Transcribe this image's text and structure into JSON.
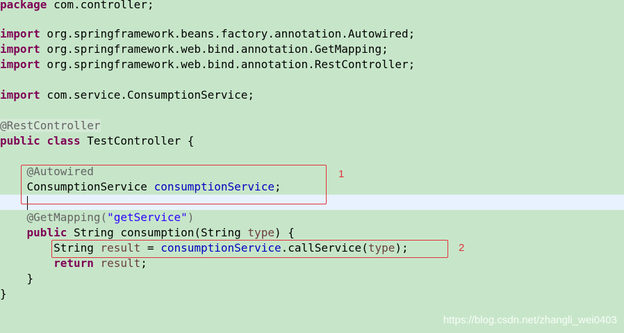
{
  "code": {
    "package_kw": "package",
    "package_name": " com.controller;",
    "import_kw": "import",
    "import1": " org.springframework.beans.factory.annotation.Autowired;",
    "import2": " org.springframework.web.bind.annotation.GetMapping;",
    "import3": " org.springframework.web.bind.annotation.RestController;",
    "import4": " com.service.ConsumptionService;",
    "ann_restcontroller": "@RestController",
    "public_kw": "public",
    "class_kw": "class",
    "class_decl": " TestController {",
    "ann_autowired": "@Autowired",
    "field_type": "ConsumptionService ",
    "field_name": "consumptionService",
    "semicolon": ";",
    "ann_getmapping": "@GetMapping(",
    "mapping_value": "\"getService\"",
    "close_paren": ")",
    "method_sig_a": " String consumption(String ",
    "param_type": "type",
    "method_sig_b": ") {",
    "stmt_type": "String ",
    "var_result": "result",
    "equals": " = ",
    "call_field": "consumptionService",
    "call_method": ".callService(",
    "call_close": ");",
    "return_kw": "return",
    "return_var": "result",
    "close_method": "}",
    "close_class": "}"
  },
  "markers": {
    "one": "1",
    "two": "2"
  },
  "watermark": "https://blog.csdn.net/zhangli_wei0403",
  "colors": {
    "background": "#c7e6c9",
    "current_line": "#e8f2fe",
    "keyword": "#7f0055",
    "annotation": "#646464",
    "field": "#0000c0",
    "local": "#6a3e3e",
    "string": "#2a00ff",
    "highlight_box": "#e0313a"
  }
}
